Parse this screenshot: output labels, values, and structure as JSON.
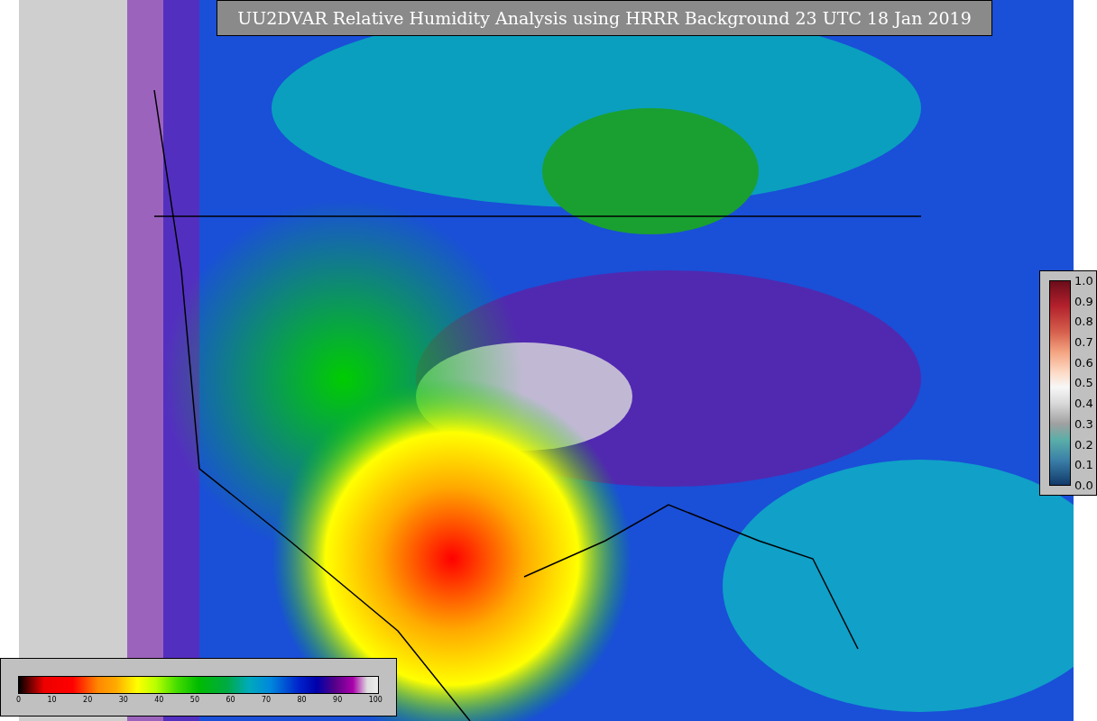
{
  "title": "UU2DVAR Relative Humidity Analysis using HRRR Background 23 UTC 18 Jan 2019",
  "map_legend": {
    "ticks": [
      "0",
      "10",
      "20",
      "30",
      "40",
      "50",
      "60",
      "70",
      "80",
      "90",
      "100"
    ]
  },
  "observation_legend": {
    "ticks": [
      "1.0",
      "0.9",
      "0.8",
      "0.7",
      "0.6",
      "0.5",
      "0.4",
      "0.3",
      "0.2",
      "0.1",
      "0.0"
    ]
  }
}
